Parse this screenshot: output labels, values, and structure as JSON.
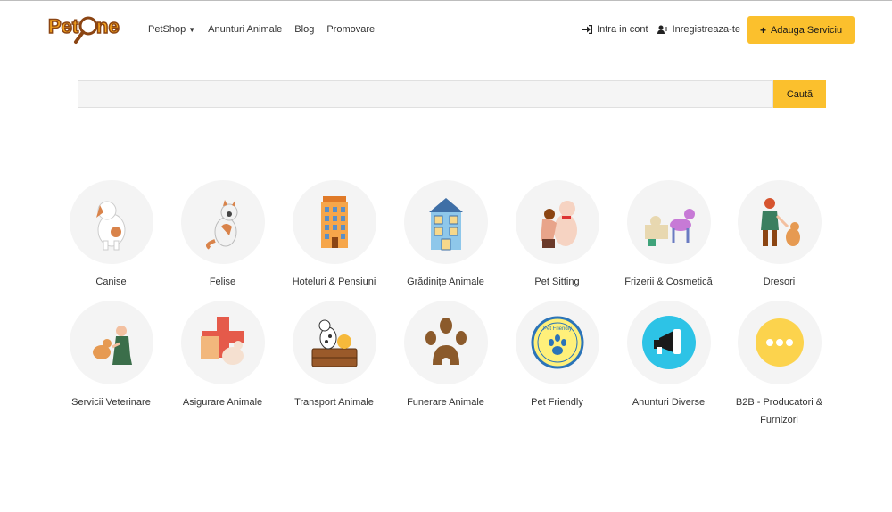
{
  "header": {
    "logo_text": "PetOne",
    "nav": [
      {
        "label": "PetShop",
        "has_dropdown": true
      },
      {
        "label": "Anunturi Animale"
      },
      {
        "label": "Blog"
      },
      {
        "label": "Promovare"
      }
    ],
    "login_label": "Intra in cont",
    "register_label": "Inregistreaza-te",
    "add_service_label": "Adauga Serviciu"
  },
  "search": {
    "placeholder": "",
    "button_label": "Caută"
  },
  "categories": [
    {
      "label": "Canise",
      "icon": "dog-icon"
    },
    {
      "label": "Felise",
      "icon": "cat-icon"
    },
    {
      "label": "Hoteluri & Pensiuni",
      "icon": "hotel-icon"
    },
    {
      "label": "Grădinițe Animale",
      "icon": "kindergarten-icon"
    },
    {
      "label": "Pet Sitting",
      "icon": "pet-sitting-icon"
    },
    {
      "label": "Frizerii & Cosmetică",
      "icon": "grooming-icon"
    },
    {
      "label": "Dresori",
      "icon": "trainer-icon"
    },
    {
      "label": "Servicii Veterinare",
      "icon": "veterinary-icon"
    },
    {
      "label": "Asigurare Animale",
      "icon": "insurance-icon"
    },
    {
      "label": "Transport Animale",
      "icon": "transport-icon"
    },
    {
      "label": "Funerare Animale",
      "icon": "paw-icon"
    },
    {
      "label": "Pet Friendly",
      "icon": "pet-friendly-badge-icon",
      "badge_text": "Pet Friendly"
    },
    {
      "label": "Anunturi Diverse",
      "icon": "megaphone-icon"
    },
    {
      "label": "B2B - Producatori & Furnizori",
      "icon": "more-dots-icon"
    }
  ],
  "colors": {
    "accent": "#fbc02d",
    "circle_bg": "#f4f4f4",
    "logo_orange": "#f7a51c",
    "logo_brown": "#8b4513"
  }
}
